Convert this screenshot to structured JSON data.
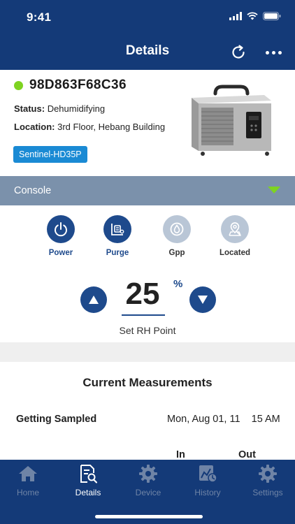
{
  "status_bar": {
    "time": "9:41"
  },
  "nav": {
    "title": "Details"
  },
  "device": {
    "id": "98D863F68C36",
    "status_label": "Status:",
    "status_value": "Dehumidifying",
    "location_label": "Location:",
    "location_value": "3rd Floor, Hebang Building",
    "model": "Sentinel-HD35P",
    "online_color": "#7ed321"
  },
  "console": {
    "label": "Console",
    "controls": [
      {
        "label": "Power",
        "icon": "power-icon",
        "active": true
      },
      {
        "label": "Purge",
        "icon": "purge-icon",
        "active": true
      },
      {
        "label": "Gpp",
        "icon": "gpp-icon",
        "active": false
      },
      {
        "label": "Located",
        "icon": "location-icon",
        "active": false
      }
    ],
    "rh": {
      "value": "25",
      "unit": "%",
      "caption": "Set RH Point"
    }
  },
  "measurements": {
    "title": "Current Measurements",
    "sampled_label": "Getting Sampled",
    "sampled_value": "Mon, Aug 01, 11    15 AM",
    "columns": [
      "In",
      "Out"
    ]
  },
  "tabs": [
    {
      "label": "Home",
      "icon": "home-icon",
      "active": false
    },
    {
      "label": "Details",
      "icon": "details-icon",
      "active": true
    },
    {
      "label": "Device",
      "icon": "device-gear-icon",
      "active": false
    },
    {
      "label": "History",
      "icon": "history-icon",
      "active": false
    },
    {
      "label": "Settings",
      "icon": "settings-gear-icon",
      "active": false
    }
  ],
  "colors": {
    "primary": "#143a78",
    "accent": "#1e4a8c",
    "console_bar": "#7b91ab",
    "badge": "#1a8ad4",
    "online": "#7ed321"
  }
}
